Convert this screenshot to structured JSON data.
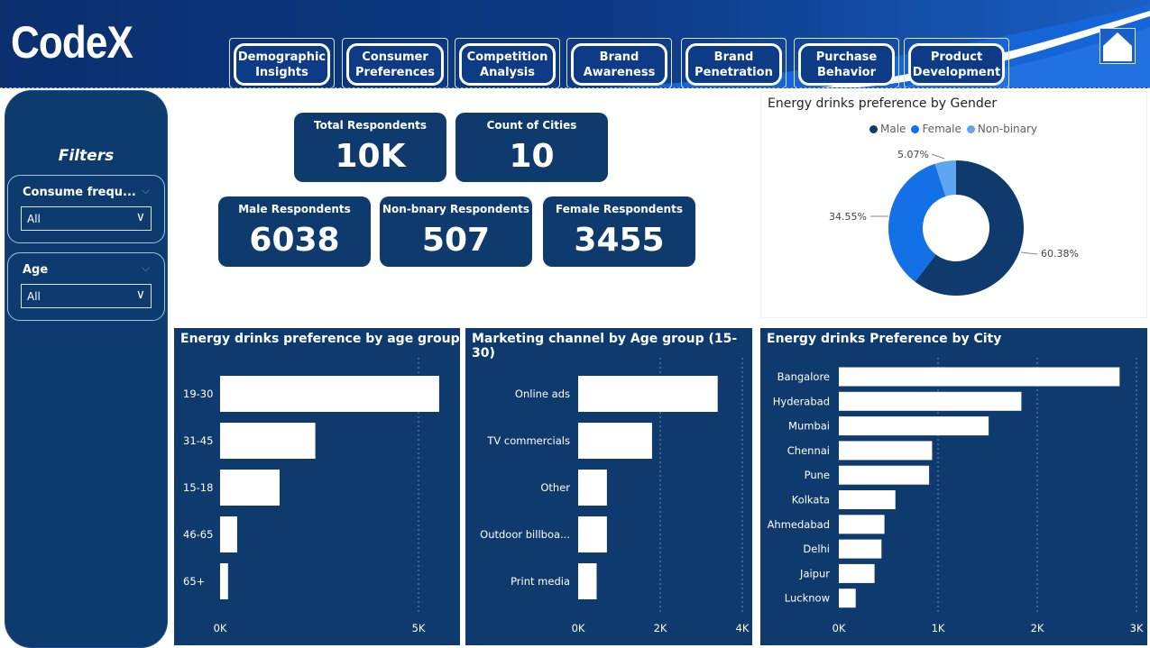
{
  "app": {
    "logo": "CodeX"
  },
  "nav": {
    "items": [
      {
        "label": "Demographic\nInsights"
      },
      {
        "label": "Consumer\nPreferences"
      },
      {
        "label": "Competition\nAnalysis"
      },
      {
        "label": "Brand\nAwareness"
      },
      {
        "label": "Brand\nPenetration"
      },
      {
        "label": "Purchase\nBehavior"
      },
      {
        "label": "Product\nDevelopment"
      }
    ],
    "home_icon": "home-icon"
  },
  "filters": {
    "title": "Filters",
    "items": [
      {
        "label": "Consume frequ...",
        "value": "All"
      },
      {
        "label": "Age",
        "value": "All"
      }
    ]
  },
  "kpis": [
    {
      "label": "Total Respondents",
      "value": "10K"
    },
    {
      "label": "Count of Cities",
      "value": "10"
    },
    {
      "label": "Male Respondents",
      "value": "6038"
    },
    {
      "label": "Non-bnary Respondents",
      "value": "507"
    },
    {
      "label": "Female Respondents",
      "value": "3455"
    }
  ],
  "colors": {
    "navy": "#0f3a6e",
    "male": "#0f3a6e",
    "female": "#1470e6",
    "nonbinary": "#5ea6ef",
    "header": "#0d3b86"
  },
  "chart_data": [
    {
      "type": "pie",
      "title": "Energy drinks preference by Gender",
      "categories": [
        "Male",
        "Female",
        "Non-binary"
      ],
      "values": [
        60.38,
        34.55,
        5.07
      ],
      "data_labels": [
        "60.38%",
        "34.55%",
        "5.07%"
      ],
      "legend": "top-center"
    },
    {
      "type": "bar",
      "orientation": "horizontal",
      "title": "Energy drinks preference by age group",
      "categories": [
        "19-30",
        "31-45",
        "15-18",
        "46-65",
        "65+"
      ],
      "values": [
        5520,
        2400,
        1500,
        430,
        200
      ],
      "xlim": [
        0,
        5500
      ],
      "xticks": [
        0,
        5000
      ],
      "xtick_labels": [
        "0K",
        "5K"
      ]
    },
    {
      "type": "bar",
      "orientation": "horizontal",
      "title": "Marketing channel by Age group (15-30)",
      "categories": [
        "Online ads",
        "TV commercials",
        "Other",
        "Outdoor billboa...",
        "Print media"
      ],
      "values": [
        3400,
        1800,
        700,
        700,
        450
      ],
      "xlim": [
        0,
        4000
      ],
      "xticks": [
        0,
        2000,
        4000
      ],
      "xtick_labels": [
        "0K",
        "2K",
        "4K"
      ]
    },
    {
      "type": "bar",
      "orientation": "horizontal",
      "title": "Energy drinks Preference by City",
      "categories": [
        "Bangalore",
        "Hyderabad",
        "Mumbai",
        "Chennai",
        "Pune",
        "Kolkata",
        "Ahmedabad",
        "Delhi",
        "Jaipur",
        "Lucknow"
      ],
      "values": [
        2830,
        1840,
        1510,
        940,
        910,
        570,
        460,
        430,
        360,
        170
      ],
      "xlim": [
        0,
        3000
      ],
      "xticks": [
        0,
        1000,
        2000,
        3000
      ],
      "xtick_labels": [
        "0K",
        "1K",
        "2K",
        "3K"
      ]
    }
  ]
}
